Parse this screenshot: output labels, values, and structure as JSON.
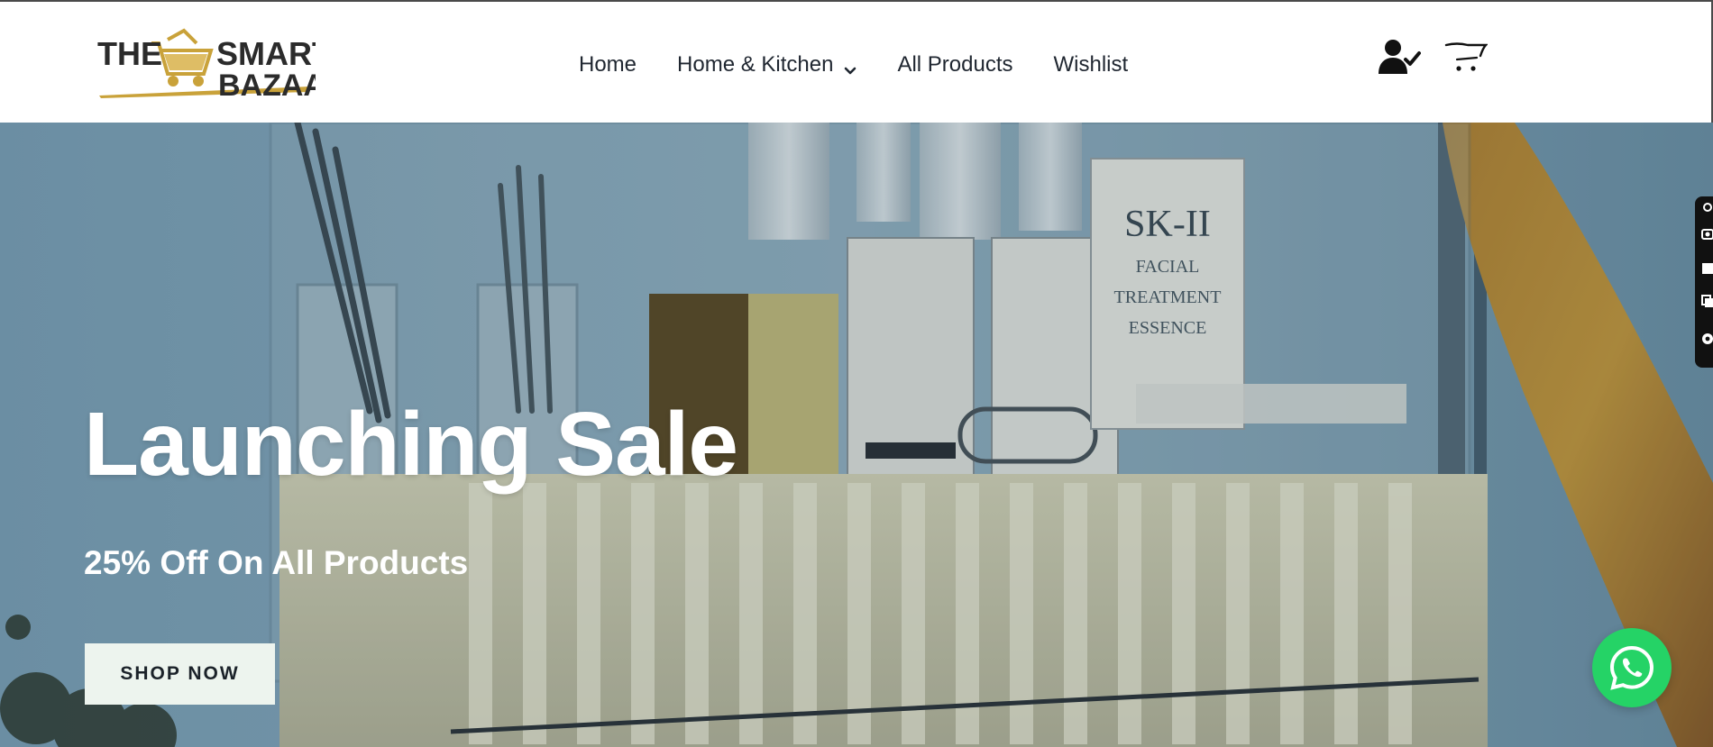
{
  "brand": {
    "logo_line1_a": "THE",
    "logo_line1_b": "SMART",
    "logo_line2": "BAZAAR",
    "gold": "#c9a23a",
    "dark": "#2b2b2b"
  },
  "nav": {
    "items": [
      {
        "label": "Home",
        "has_dropdown": false
      },
      {
        "label": "Home & Kitchen",
        "has_dropdown": true
      },
      {
        "label": "All Products",
        "has_dropdown": false
      },
      {
        "label": "Wishlist",
        "has_dropdown": false
      }
    ]
  },
  "header_icons": [
    "account-icon",
    "cart-icon"
  ],
  "hero": {
    "title": "Launching Sale",
    "subtitle": "25% Off On All Products",
    "cta_label": "SHOP NOW",
    "product_print": {
      "brand": "SK-II",
      "line1": "FACIAL",
      "line2": "TREATMENT",
      "line3": "ESSENCE"
    }
  },
  "side_toolbar": [
    "link-icon",
    "camera-icon",
    "square-icon",
    "copy-icon",
    "gear-icon"
  ],
  "whatsapp": {
    "icon": "whatsapp-icon",
    "color": "#25d366"
  }
}
